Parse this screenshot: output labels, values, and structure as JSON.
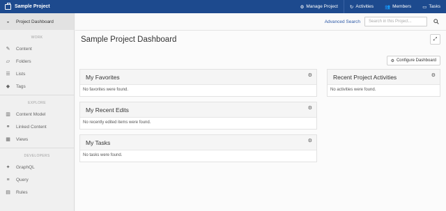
{
  "topbar": {
    "project_name": "Sample Project",
    "nav": [
      {
        "icon": "gear-icon",
        "glyph": "⚙",
        "label": "Manage Project"
      },
      {
        "icon": "activities-icon",
        "glyph": "↻",
        "label": "Activities"
      },
      {
        "icon": "members-icon",
        "glyph": "👥",
        "label": "Members"
      },
      {
        "icon": "tasks-icon",
        "glyph": "▭",
        "label": "Tasks"
      }
    ]
  },
  "sidebar": {
    "active": {
      "label": "Project Dashboard",
      "glyph": "◒"
    },
    "sections": [
      {
        "title": "WORK",
        "items": [
          {
            "label": "Content",
            "glyph": "✎"
          },
          {
            "label": "Folders",
            "glyph": "▱"
          },
          {
            "label": "Lists",
            "glyph": "☰"
          },
          {
            "label": "Tags",
            "glyph": "◆"
          }
        ]
      },
      {
        "title": "EXPLORE",
        "items": [
          {
            "label": "Content Model",
            "glyph": "▥"
          },
          {
            "label": "Linked Content",
            "glyph": "⚭"
          },
          {
            "label": "Views",
            "glyph": "▦"
          }
        ]
      },
      {
        "title": "DEVELOPERS",
        "items": [
          {
            "label": "GraphQL",
            "glyph": "✦"
          },
          {
            "label": "Query",
            "glyph": "≡"
          },
          {
            "label": "Rules",
            "glyph": "▤"
          }
        ]
      }
    ]
  },
  "subheader": {
    "advanced_search": "Advanced Search",
    "search_placeholder": "Search in this Project..."
  },
  "main": {
    "title": "Sample Project Dashboard",
    "configure_label": "Configure Dashboard",
    "widgets": {
      "favorites": {
        "title": "My Favorites",
        "empty": "No favorites were found."
      },
      "recent_edits": {
        "title": "My Recent Edits",
        "empty": "No recently edited items were found."
      },
      "tasks": {
        "title": "My Tasks",
        "empty": "No tasks were found."
      },
      "activities": {
        "title": "Recent Project Activities",
        "empty": "No activities were found."
      }
    }
  }
}
